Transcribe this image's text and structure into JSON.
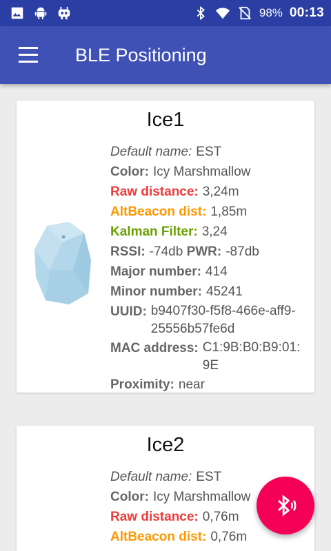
{
  "status_bar": {
    "icons_left": [
      "image-icon",
      "android-icon",
      "cyanogen-icon"
    ],
    "icons_right": [
      "bluetooth-icon",
      "wifi-icon",
      "no-sim-icon",
      "battery-icon"
    ],
    "battery": "98%",
    "time": "00:13"
  },
  "app_bar": {
    "title": "BLE Positioning",
    "menu_icon": "hamburger-menu-icon"
  },
  "beacons": [
    {
      "name": "Ice1",
      "default_name_label": "Default name:",
      "default_name": "EST",
      "color_label": "Color:",
      "color": "Icy Marshmallow",
      "raw_distance_label": "Raw distance:",
      "raw_distance": "3,24m",
      "altbeacon_label": "AltBeacon dist:",
      "altbeacon": "1,85m",
      "kalman_label": "Kalman Filter:",
      "kalman": "3,24",
      "rssi_label": "RSSI:",
      "rssi": "-74db",
      "pwr_label": "PWR:",
      "pwr": "-87db",
      "major_label": "Major number:",
      "major": "414",
      "minor_label": "Minor number:",
      "minor": "45241",
      "uuid_label": "UUID:",
      "uuid": "b9407f30-f5f8-466e-aff9-25556b57fe6d",
      "mac_label": "MAC address:",
      "mac": "C1:9B:B0:B9:01:9E",
      "proximity_label": "Proximity:",
      "proximity": "near"
    },
    {
      "name": "Ice2",
      "default_name_label": "Default name:",
      "default_name": "EST",
      "color_label": "Color:",
      "color": "Icy Marshmallow",
      "raw_distance_label": "Raw distance:",
      "raw_distance": "0,76m",
      "altbeacon_label": "AltBeacon dist:",
      "altbeacon": "0,76m"
    }
  ],
  "fab": {
    "icon": "bluetooth-searching-icon"
  },
  "colors": {
    "status_bar": "#2a3ea3",
    "app_bar": "#3f51b5",
    "raw_distance": "#ef3b3b",
    "altbeacon": "#ff9800",
    "kalman": "#6aa000",
    "fab": "#f50057"
  }
}
